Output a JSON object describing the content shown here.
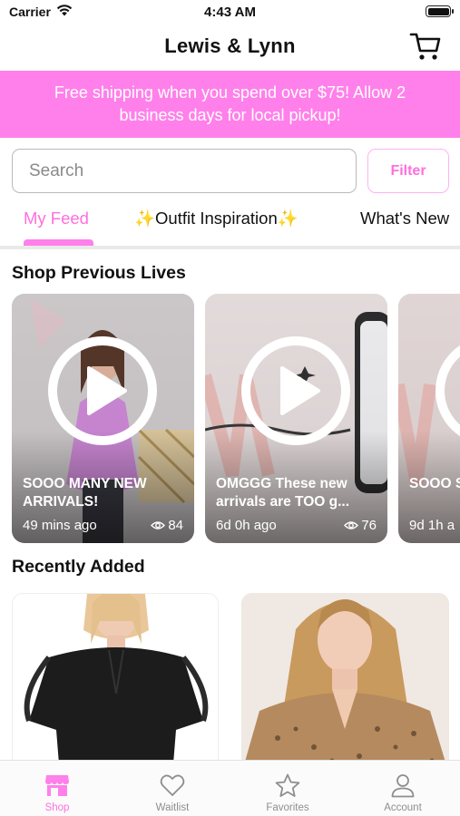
{
  "status_bar": {
    "carrier": "Carrier",
    "time": "4:43 AM"
  },
  "header": {
    "title": "Lewis & Lynn",
    "cart_icon": "cart-icon"
  },
  "promo": {
    "text": "Free shipping when you spend over $75! Allow 2 business days for local pickup!"
  },
  "search": {
    "placeholder": "Search",
    "value": "",
    "filter_label": "Filter"
  },
  "tabs": [
    {
      "label": "My Feed",
      "active": true
    },
    {
      "label": "✨Outfit Inspiration✨",
      "active": false
    },
    {
      "label": "What's New",
      "active": false
    }
  ],
  "sections": {
    "previous_lives": "Shop Previous Lives",
    "recently_added": "Recently Added"
  },
  "lives": [
    {
      "title": "SOOO MANY NEW ARRIVALS!",
      "time": "49 mins ago",
      "views": "84"
    },
    {
      "title": "OMGGG These new arrivals are TOO g...",
      "time": "6d 0h ago",
      "views": "76"
    },
    {
      "title": "SOOO SPRING",
      "time": "9d 1h a",
      "views": ""
    }
  ],
  "bottom_nav": [
    {
      "label": "Shop",
      "icon": "shop-icon",
      "active": true
    },
    {
      "label": "Waitlist",
      "icon": "heart-icon",
      "active": false
    },
    {
      "label": "Favorites",
      "icon": "star-icon",
      "active": false
    },
    {
      "label": "Account",
      "icon": "account-icon",
      "active": false
    }
  ],
  "colors": {
    "accent": "#ff80ea",
    "accent_text": "#ff6fdd",
    "inactive": "#8e8e8e"
  }
}
